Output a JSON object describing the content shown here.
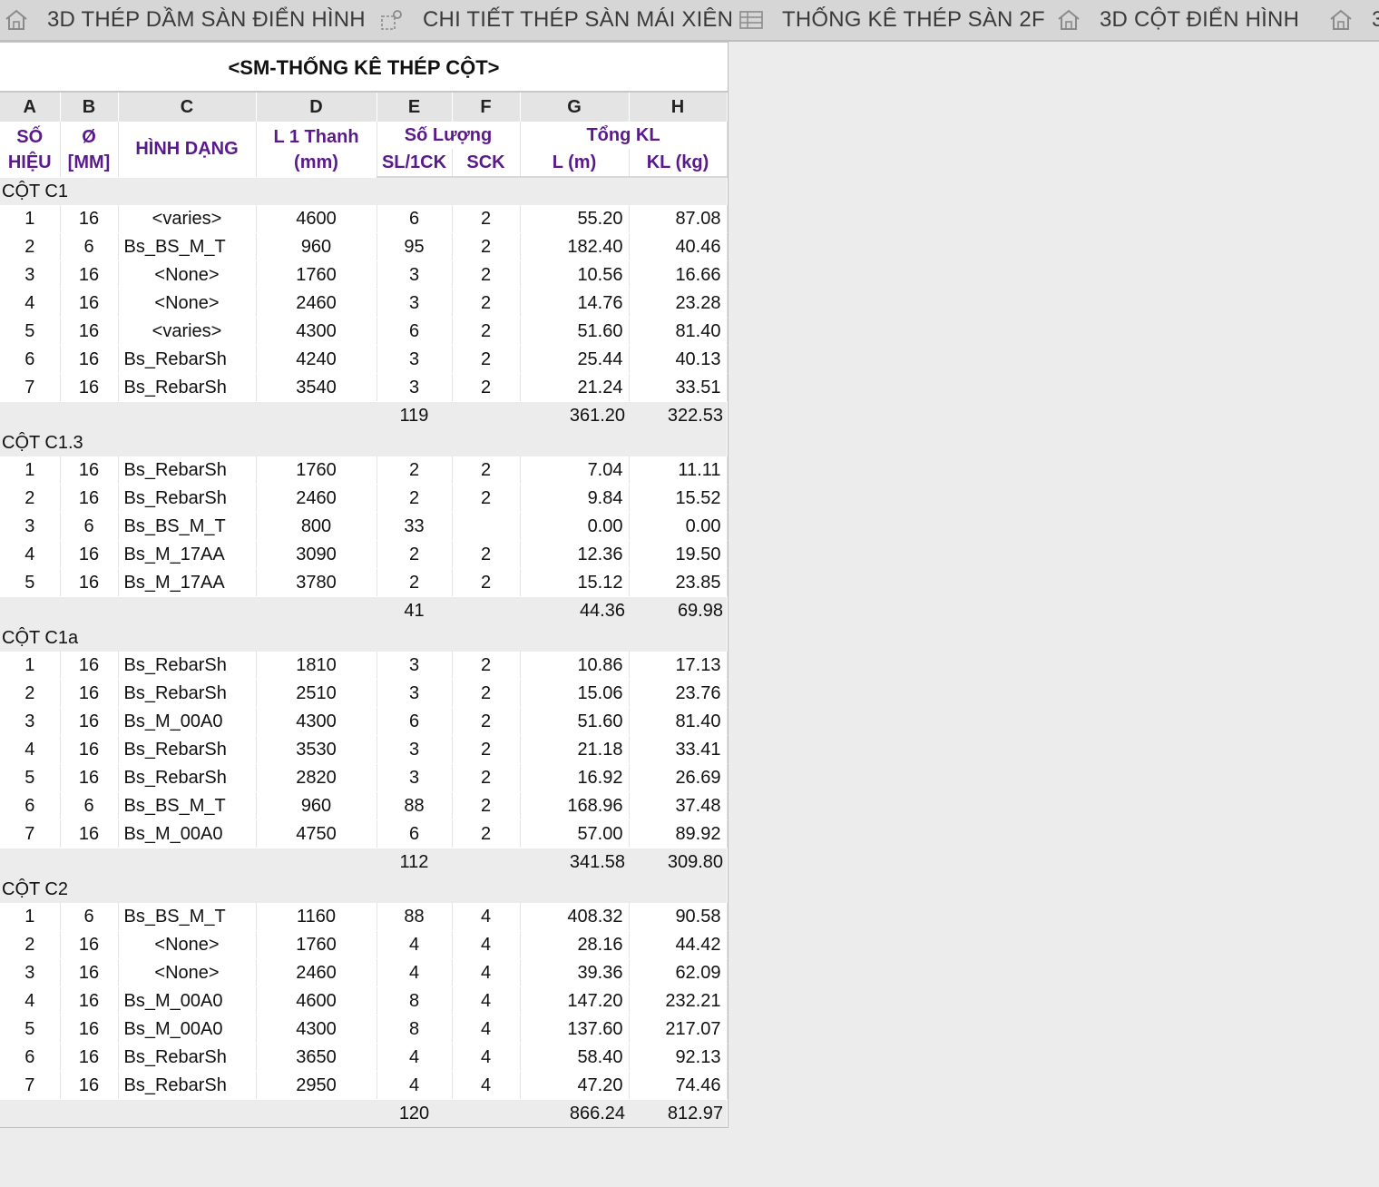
{
  "tabs": [
    {
      "label": "3D THÉP DẦM SÀN ĐIỂN HÌNH",
      "icon": "house-icon"
    },
    {
      "label": "CHI TIẾT THÉP SÀN MÁI XIÊN",
      "icon": "detail-view-icon"
    },
    {
      "label": "THỐNG KÊ THÉP SÀN 2F",
      "icon": "schedule-table-icon"
    },
    {
      "label": "3D CỘT ĐIỂN HÌNH",
      "icon": "house-icon"
    },
    {
      "label": "3",
      "icon": "house-icon"
    }
  ],
  "schedule": {
    "title": "<SM-THỐNG KÊ THÉP CỘT>",
    "letters": [
      "A",
      "B",
      "C",
      "D",
      "E",
      "F",
      "G",
      "H"
    ],
    "headers": {
      "so_hieu": "SỐ HIỆU",
      "dia": "Ø [MM]",
      "shape": "HÌNH DẠNG",
      "length": "L 1 Thanh (mm)",
      "qty_group": "Số Lượng",
      "qty_per": "SL/1CK",
      "qty_sck": "SCK",
      "total_group": "Tổng KL",
      "total_l": "L (m)",
      "total_kg": "KL (kg)"
    },
    "groups": [
      {
        "name": "CỘT C1",
        "rows": [
          [
            "1",
            "16",
            "<varies>",
            "4600",
            "6",
            "2",
            "55.20",
            "87.08"
          ],
          [
            "2",
            "6",
            "Bs_BS_M_T",
            "960",
            "95",
            "2",
            "182.40",
            "40.46"
          ],
          [
            "3",
            "16",
            "<None>",
            "1760",
            "3",
            "2",
            "10.56",
            "16.66"
          ],
          [
            "4",
            "16",
            "<None>",
            "2460",
            "3",
            "2",
            "14.76",
            "23.28"
          ],
          [
            "5",
            "16",
            "<varies>",
            "4300",
            "6",
            "2",
            "51.60",
            "81.40"
          ],
          [
            "6",
            "16",
            "Bs_RebarSh",
            "4240",
            "3",
            "2",
            "25.44",
            "40.13"
          ],
          [
            "7",
            "16",
            "Bs_RebarSh",
            "3540",
            "3",
            "2",
            "21.24",
            "33.51"
          ]
        ],
        "total": {
          "qty": "119",
          "l": "361.20",
          "kg": "322.53"
        }
      },
      {
        "name": "CỘT C1.3",
        "rows": [
          [
            "1",
            "16",
            "Bs_RebarSh",
            "1760",
            "2",
            "2",
            "7.04",
            "11.11"
          ],
          [
            "2",
            "16",
            "Bs_RebarSh",
            "2460",
            "2",
            "2",
            "9.84",
            "15.52"
          ],
          [
            "3",
            "6",
            "Bs_BS_M_T",
            "800",
            "33",
            "",
            "0.00",
            "0.00"
          ],
          [
            "4",
            "16",
            "Bs_M_17AA",
            "3090",
            "2",
            "2",
            "12.36",
            "19.50"
          ],
          [
            "5",
            "16",
            "Bs_M_17AA",
            "3780",
            "2",
            "2",
            "15.12",
            "23.85"
          ]
        ],
        "total": {
          "qty": "41",
          "l": "44.36",
          "kg": "69.98"
        }
      },
      {
        "name": "CỘT C1a",
        "rows": [
          [
            "1",
            "16",
            "Bs_RebarSh",
            "1810",
            "3",
            "2",
            "10.86",
            "17.13"
          ],
          [
            "2",
            "16",
            "Bs_RebarSh",
            "2510",
            "3",
            "2",
            "15.06",
            "23.76"
          ],
          [
            "3",
            "16",
            "Bs_M_00A0",
            "4300",
            "6",
            "2",
            "51.60",
            "81.40"
          ],
          [
            "4",
            "16",
            "Bs_RebarSh",
            "3530",
            "3",
            "2",
            "21.18",
            "33.41"
          ],
          [
            "5",
            "16",
            "Bs_RebarSh",
            "2820",
            "3",
            "2",
            "16.92",
            "26.69"
          ],
          [
            "6",
            "6",
            "Bs_BS_M_T",
            "960",
            "88",
            "2",
            "168.96",
            "37.48"
          ],
          [
            "7",
            "16",
            "Bs_M_00A0",
            "4750",
            "6",
            "2",
            "57.00",
            "89.92"
          ]
        ],
        "total": {
          "qty": "112",
          "l": "341.58",
          "kg": "309.80"
        }
      },
      {
        "name": "CỘT C2",
        "rows": [
          [
            "1",
            "6",
            "Bs_BS_M_T",
            "1160",
            "88",
            "4",
            "408.32",
            "90.58"
          ],
          [
            "2",
            "16",
            "<None>",
            "1760",
            "4",
            "4",
            "28.16",
            "44.42"
          ],
          [
            "3",
            "16",
            "<None>",
            "2460",
            "4",
            "4",
            "39.36",
            "62.09"
          ],
          [
            "4",
            "16",
            "Bs_M_00A0",
            "4600",
            "8",
            "4",
            "147.20",
            "232.21"
          ],
          [
            "5",
            "16",
            "Bs_M_00A0",
            "4300",
            "8",
            "4",
            "137.60",
            "217.07"
          ],
          [
            "6",
            "16",
            "Bs_RebarSh",
            "3650",
            "4",
            "4",
            "58.40",
            "92.13"
          ],
          [
            "7",
            "16",
            "Bs_RebarSh",
            "2950",
            "4",
            "4",
            "47.20",
            "74.46"
          ]
        ],
        "total": {
          "qty": "120",
          "l": "866.24",
          "kg": "812.97"
        }
      }
    ]
  },
  "colors": {
    "header_text": "#5a1a8c",
    "group_band": "#ececec",
    "tabbar": "#d6d6d6"
  }
}
